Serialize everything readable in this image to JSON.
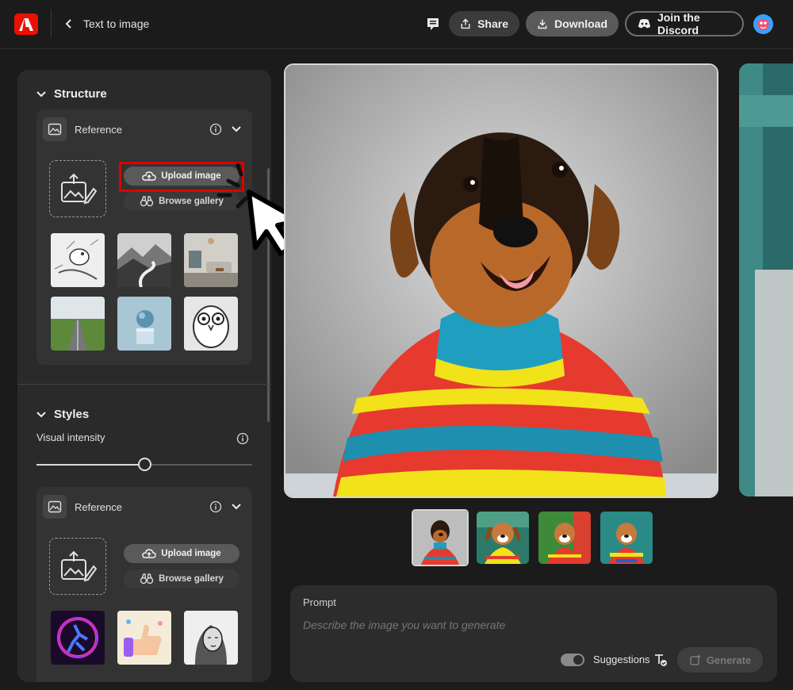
{
  "header": {
    "page_title": "Text to image",
    "share_label": "Share",
    "download_label": "Download",
    "discord_label": "Join the Discord",
    "icons": [
      "adobe-logo-icon",
      "back-arrow-icon",
      "comment-icon",
      "share-icon",
      "download-icon",
      "discord-icon",
      "avatar"
    ]
  },
  "structure": {
    "title": "Structure",
    "reference": {
      "label": "Reference",
      "upload_label": "Upload image",
      "gallery_label": "Browse gallery",
      "thumbnails": [
        "blue-bird-sketch",
        "mountain-river",
        "living-room",
        "field-road",
        "sphere-on-pedestal",
        "owl-line-art"
      ]
    }
  },
  "styles": {
    "title": "Styles",
    "visual_intensity_label": "Visual intensity",
    "visual_intensity_value": 0.5,
    "reference": {
      "label": "Reference",
      "upload_label": "Upload image",
      "gallery_label": "Browse gallery",
      "thumbnails": [
        "neon-runner",
        "3d-thumbs-up",
        "engraved-portrait"
      ]
    }
  },
  "prompt": {
    "label": "Prompt",
    "placeholder": "Describe the image you want to generate",
    "suggestions_label": "Suggestions",
    "suggestions_on": true,
    "generate_label": "Generate"
  },
  "colors": {
    "accent": "#eb1000",
    "highlight": "#e00000",
    "background": "#1b1b1b",
    "panel": "#2a2a2a"
  }
}
